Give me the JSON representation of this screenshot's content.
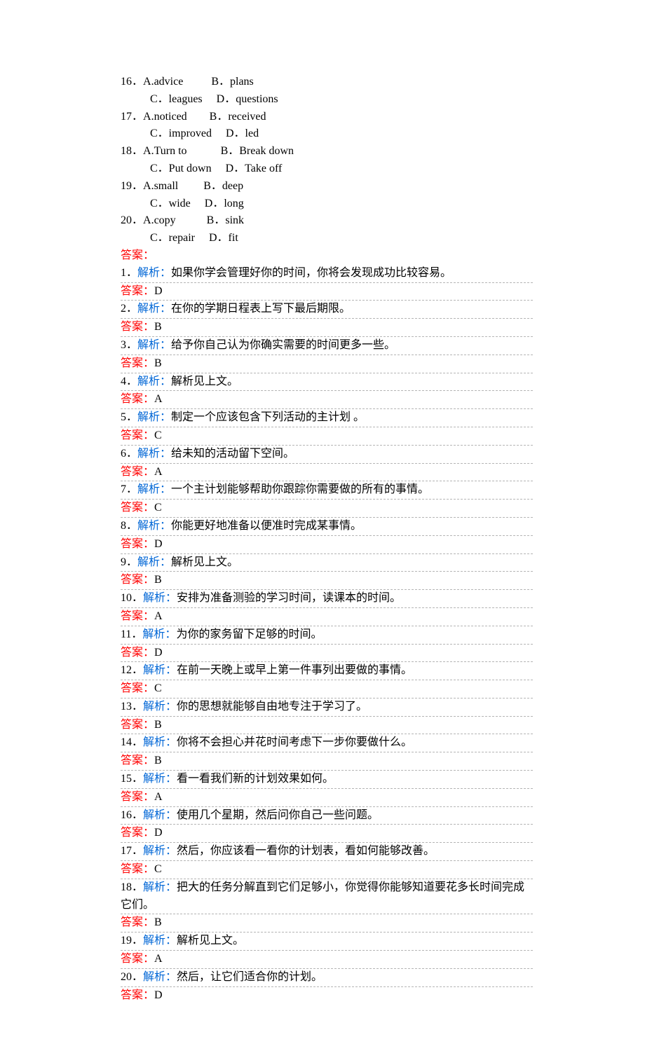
{
  "questions": [
    {
      "num": "16",
      "a": "A.advice",
      "b": "B．plans",
      "c": "C．leagues",
      "d": "D．questions",
      "padA": "pad-a1",
      "padC": "pad-c1"
    },
    {
      "num": "17",
      "a": "A.noticed",
      "b": "B．received",
      "c": "C．improved",
      "d": "D．led",
      "padA": "pad-a2",
      "padC": "pad-c2"
    },
    {
      "num": "18",
      "a": "A.Turn to",
      "b": "B．Break down",
      "c": "C．Put down",
      "d": "D．Take off",
      "padA": "pad-a3",
      "padC": "pad-c3"
    },
    {
      "num": "19",
      "a": "A.small",
      "b": "B．deep",
      "c": "C．wide",
      "d": "D．long",
      "padA": "pad-a4",
      "padC": "pad-c4"
    },
    {
      "num": "20",
      "a": "A.copy",
      "b": "B．sink",
      "c": "C．repair",
      "d": "D．fit",
      "padA": "pad-a5",
      "padC": "pad-c5"
    }
  ],
  "answersHeader": "答案：",
  "analysisLabel": "解析：",
  "answerLabel": "答案：",
  "answers": [
    {
      "num": "1",
      "analysis": "如果你学会管理好你的时间，你将会发现成功比较容易。",
      "ans": "D"
    },
    {
      "num": "2",
      "analysis": "在你的学期日程表上写下最后期限。",
      "ans": "B"
    },
    {
      "num": "3",
      "analysis": "给予你自己认为你确实需要的时间更多一些。",
      "ans": "B"
    },
    {
      "num": "4",
      "analysis": "解析见上文。",
      "ans": "A"
    },
    {
      "num": "5",
      "analysis": "制定一个应该包含下列活动的主计划 。",
      "ans": "C"
    },
    {
      "num": "6",
      "analysis": "给未知的活动留下空间。",
      "ans": "A"
    },
    {
      "num": "7",
      "analysis": "一个主计划能够帮助你跟踪你需要做的所有的事情。",
      "ans": "C"
    },
    {
      "num": "8",
      "analysis": "你能更好地准备以便准时完成某事情。",
      "ans": "D"
    },
    {
      "num": "9",
      "analysis": "解析见上文。",
      "ans": "B"
    },
    {
      "num": "10",
      "analysis": "安排为准备测验的学习时间，读课本的时间。",
      "ans": "A"
    },
    {
      "num": "11",
      "analysis": "为你的家务留下足够的时间。",
      "ans": "D"
    },
    {
      "num": "12",
      "analysis": "在前一天晚上或早上第一件事列出要做的事情。",
      "ans": "C"
    },
    {
      "num": "13",
      "analysis": "你的思想就能够自由地专注于学习了。",
      "ans": "B"
    },
    {
      "num": "14",
      "analysis": "你将不会担心并花时间考虑下一步你要做什么。",
      "ans": "B"
    },
    {
      "num": "15",
      "analysis": "看一看我们新的计划效果如何。",
      "ans": "A"
    },
    {
      "num": "16",
      "analysis": "使用几个星期，然后问你自己一些问题。",
      "ans": "D"
    },
    {
      "num": "17",
      "analysis": "然后，你应该看一看你的计划表，看如何能够改善。",
      "ans": "C"
    },
    {
      "num": "18",
      "analysis": "把大的任务分解直到它们足够小，你觉得你能够知道要花多长时间完成它们。",
      "ans": "B"
    },
    {
      "num": "19",
      "analysis": "解析见上文。",
      "ans": "A"
    },
    {
      "num": "20",
      "analysis": "然后，让它们适合你的计划。",
      "ans": "D"
    }
  ]
}
